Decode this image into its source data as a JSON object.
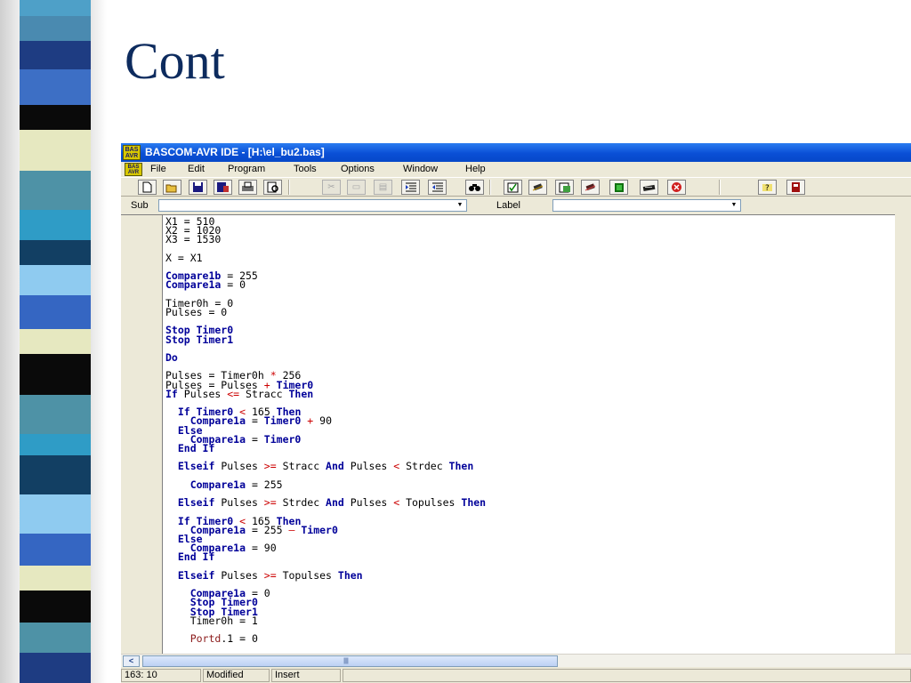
{
  "slide": {
    "title": "Cont"
  },
  "window": {
    "title": "BASCOM-AVR IDE - [H:\\el_bu2.bas]",
    "app_icon_text": "BAS AVR"
  },
  "menu": [
    "File",
    "Edit",
    "Program",
    "Tools",
    "Options",
    "Window",
    "Help"
  ],
  "subbar": {
    "sub_label": "Sub",
    "label_label": "Label"
  },
  "code": [
    [
      "X1 = 510"
    ],
    [
      "X2 = 1020"
    ],
    [
      "X3 = 1530"
    ],
    [],
    [
      "X = X1"
    ],
    [],
    [
      "Compare1b",
      " = 255"
    ],
    [
      "Compare1a",
      " = 0"
    ],
    [],
    [
      "Timer0h = 0"
    ],
    [
      "Pulses = 0"
    ],
    [],
    [
      "Stop Timer0"
    ],
    [
      "Stop Timer1"
    ],
    [],
    [
      "Do"
    ],
    [],
    [
      "Pulses = Timer0h ",
      "*",
      " 256"
    ],
    [
      "Pulses = Pulses ",
      "+",
      " ",
      "Timer0"
    ],
    [
      "If",
      " Pulses ",
      "<=",
      " Stracc ",
      "Then"
    ],
    [],
    [
      "  ",
      "If Timer0",
      " ",
      "<",
      " 165 ",
      "Then"
    ],
    [
      "    ",
      "Compare1a",
      " = ",
      "Timer0",
      " ",
      "+",
      " 90"
    ],
    [
      "  ",
      "Else"
    ],
    [
      "    ",
      "Compare1a",
      " = ",
      "Timer0"
    ],
    [
      "  ",
      "End If"
    ],
    [],
    [
      "  ",
      "Elseif",
      " Pulses ",
      ">=",
      " Stracc ",
      "And",
      " Pulses ",
      "<",
      " Strdec ",
      "Then"
    ],
    [],
    [
      "    ",
      "Compare1a",
      " = 255"
    ],
    [],
    [
      "  ",
      "Elseif",
      " Pulses ",
      ">=",
      " Strdec ",
      "And",
      " Pulses ",
      "<",
      " Topulses ",
      "Then"
    ],
    [],
    [
      "  ",
      "If Timer0",
      " ",
      "<",
      " 165 ",
      "Then"
    ],
    [
      "    ",
      "Compare1a",
      " = 255 ",
      "–",
      " ",
      "Timer0"
    ],
    [
      "  ",
      "Else"
    ],
    [
      "    ",
      "Compare1a",
      " = 90"
    ],
    [
      "  ",
      "End If"
    ],
    [],
    [
      "  ",
      "Elseif",
      " Pulses ",
      ">=",
      " Topulses ",
      "Then"
    ],
    [],
    [
      "    ",
      "Compare1a",
      " = 0"
    ],
    [
      "    ",
      "Stop Timer0"
    ],
    [
      "    ",
      "Stop Timer1"
    ],
    [
      "    Timer0h = 1"
    ],
    [],
    [
      "    ",
      "Portd",
      ".1 = 0"
    ]
  ],
  "status": {
    "position": "163: 10",
    "modified": "Modified",
    "mode": "Insert"
  },
  "colors": {
    "keyword": "#000099",
    "operator": "#cc0000",
    "title_blue": "#0a4fd6",
    "slide_title": "#0d2b5e"
  }
}
